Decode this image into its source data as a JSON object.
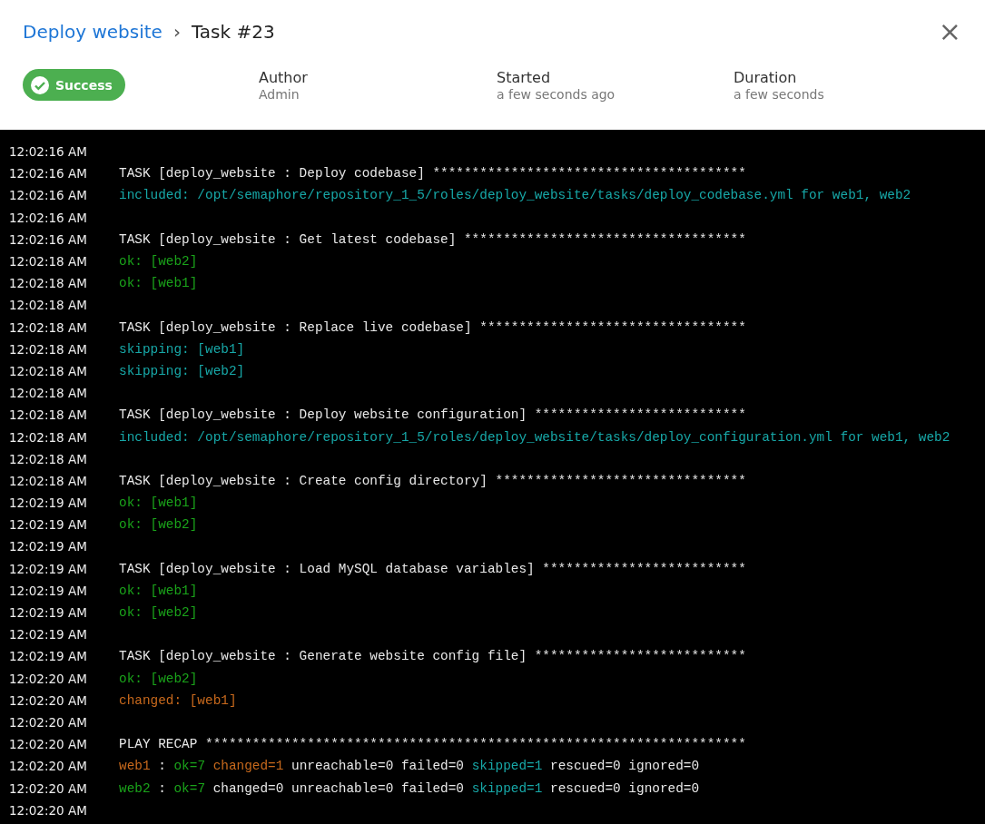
{
  "header": {
    "breadcrumb": {
      "parent": "Deploy website",
      "separator": "›",
      "current": "Task #23"
    },
    "close_label": "×"
  },
  "status": {
    "label": "Success",
    "kind": "success"
  },
  "details": [
    {
      "label": "Author",
      "value": "Admin"
    },
    {
      "label": "Started",
      "value": "a few seconds ago"
    },
    {
      "label": "Duration",
      "value": "a few seconds"
    }
  ],
  "log": [
    {
      "time": "12:02:16 AM"
    },
    {
      "time": "12:02:16 AM",
      "segments": [
        {
          "kind": "plain",
          "text": "TASK [deploy_website : Deploy codebase] ****************************************"
        }
      ]
    },
    {
      "time": "12:02:16 AM",
      "segments": [
        {
          "kind": "info",
          "text": "included: /opt/semaphore/repository_1_5/roles/deploy_website/tasks/deploy_codebase.yml for web1, web2"
        }
      ]
    },
    {
      "time": "12:02:16 AM"
    },
    {
      "time": "12:02:16 AM",
      "segments": [
        {
          "kind": "plain",
          "text": "TASK [deploy_website : Get latest codebase] ************************************"
        }
      ]
    },
    {
      "time": "12:02:18 AM",
      "segments": [
        {
          "kind": "ok",
          "text": "ok: [web2]"
        }
      ]
    },
    {
      "time": "12:02:18 AM",
      "segments": [
        {
          "kind": "ok",
          "text": "ok: [web1]"
        }
      ]
    },
    {
      "time": "12:02:18 AM"
    },
    {
      "time": "12:02:18 AM",
      "segments": [
        {
          "kind": "plain",
          "text": "TASK [deploy_website : Replace live codebase] **********************************"
        }
      ]
    },
    {
      "time": "12:02:18 AM",
      "segments": [
        {
          "kind": "info",
          "text": "skipping: [web1]"
        }
      ]
    },
    {
      "time": "12:02:18 AM",
      "segments": [
        {
          "kind": "info",
          "text": "skipping: [web2]"
        }
      ]
    },
    {
      "time": "12:02:18 AM"
    },
    {
      "time": "12:02:18 AM",
      "segments": [
        {
          "kind": "plain",
          "text": "TASK [deploy_website : Deploy website configuration] ***************************"
        }
      ]
    },
    {
      "time": "12:02:18 AM",
      "segments": [
        {
          "kind": "info",
          "text": "included: /opt/semaphore/repository_1_5/roles/deploy_website/tasks/deploy_configuration.yml for web1, web2"
        }
      ]
    },
    {
      "time": "12:02:18 AM"
    },
    {
      "time": "12:02:18 AM",
      "segments": [
        {
          "kind": "plain",
          "text": "TASK [deploy_website : Create config directory] ********************************"
        }
      ]
    },
    {
      "time": "12:02:19 AM",
      "segments": [
        {
          "kind": "ok",
          "text": "ok: [web1]"
        }
      ]
    },
    {
      "time": "12:02:19 AM",
      "segments": [
        {
          "kind": "ok",
          "text": "ok: [web2]"
        }
      ]
    },
    {
      "time": "12:02:19 AM"
    },
    {
      "time": "12:02:19 AM",
      "segments": [
        {
          "kind": "plain",
          "text": "TASK [deploy_website : Load MySQL database variables] **************************"
        }
      ]
    },
    {
      "time": "12:02:19 AM",
      "segments": [
        {
          "kind": "ok",
          "text": "ok: [web1]"
        }
      ]
    },
    {
      "time": "12:02:19 AM",
      "segments": [
        {
          "kind": "ok",
          "text": "ok: [web2]"
        }
      ]
    },
    {
      "time": "12:02:19 AM"
    },
    {
      "time": "12:02:19 AM",
      "segments": [
        {
          "kind": "plain",
          "text": "TASK [deploy_website : Generate website config file] ***************************"
        }
      ]
    },
    {
      "time": "12:02:20 AM",
      "segments": [
        {
          "kind": "ok",
          "text": "ok: [web2]"
        }
      ]
    },
    {
      "time": "12:02:20 AM",
      "segments": [
        {
          "kind": "changed",
          "text": "changed: [web1]"
        }
      ]
    },
    {
      "time": "12:02:20 AM"
    },
    {
      "time": "12:02:20 AM",
      "segments": [
        {
          "kind": "plain",
          "text": "PLAY RECAP *********************************************************************"
        }
      ]
    },
    {
      "time": "12:02:20 AM",
      "segments": [
        {
          "kind": "changed",
          "text": "web1"
        },
        {
          "kind": "plain",
          "text": " : "
        },
        {
          "kind": "ok",
          "text": "ok=7"
        },
        {
          "kind": "changed",
          "text": " changed=1"
        },
        {
          "kind": "plain",
          "text": " unreachable=0 failed=0 "
        },
        {
          "kind": "info",
          "text": "skipped=1"
        },
        {
          "kind": "plain",
          "text": " rescued=0 ignored=0"
        }
      ]
    },
    {
      "time": "12:02:20 AM",
      "segments": [
        {
          "kind": "ok",
          "text": "web2"
        },
        {
          "kind": "plain",
          "text": " : "
        },
        {
          "kind": "ok",
          "text": "ok=7"
        },
        {
          "kind": "plain",
          "text": " changed=0 unreachable=0 failed=0 "
        },
        {
          "kind": "info",
          "text": "skipped=1"
        },
        {
          "kind": "plain",
          "text": " rescued=0 ignored=0"
        }
      ]
    },
    {
      "time": "12:02:20 AM"
    }
  ]
}
